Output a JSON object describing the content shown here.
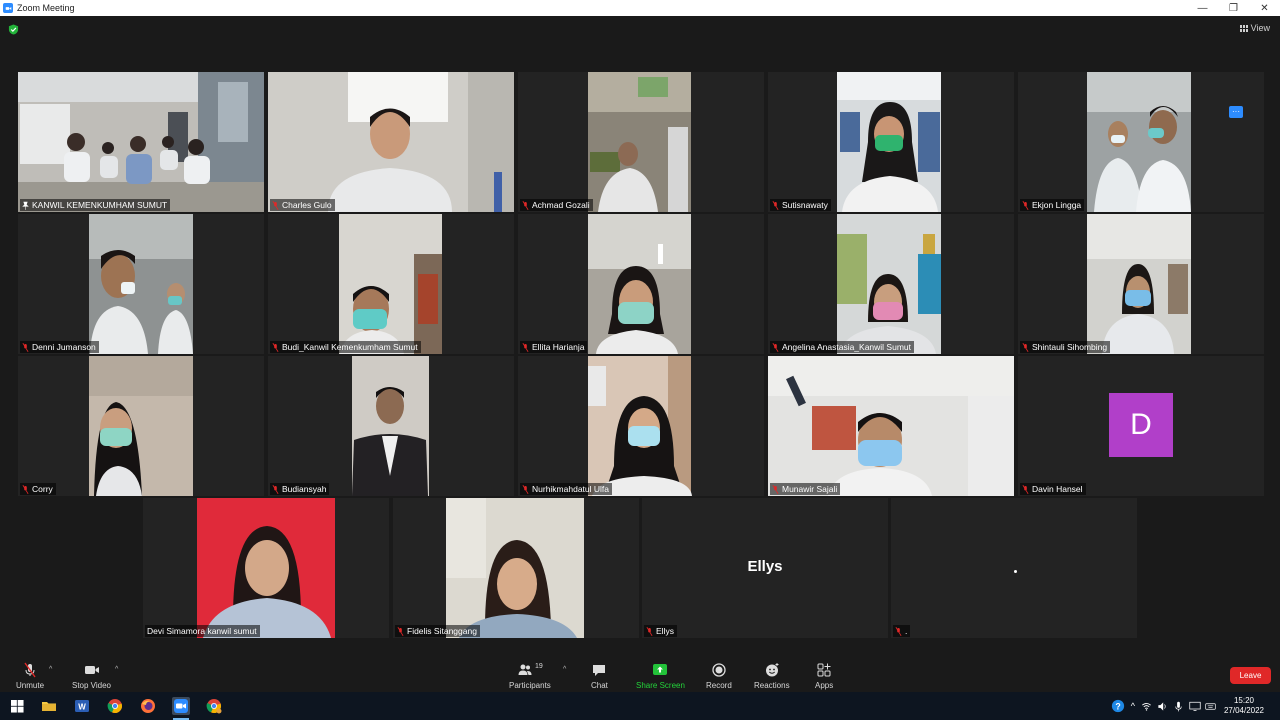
{
  "window": {
    "title": "Zoom Meeting",
    "minimize": "—",
    "restore": "❐",
    "close": "✕"
  },
  "topbar": {
    "view_label": "View"
  },
  "participants_tiles": [
    {
      "name": "KANWIL KEMENKUMHAM SUMUT",
      "active": true
    },
    {
      "name": "Charles Gulo"
    },
    {
      "name": "Achmad Gozali"
    },
    {
      "name": "Sutisnawaty"
    },
    {
      "name": "Ekjon Lingga"
    },
    {
      "name": "Denni Jumanson"
    },
    {
      "name": "Budi_Kanwil Kemenkumham Sumut"
    },
    {
      "name": "Ellita Harianja"
    },
    {
      "name": "Angelina Anastasia_Kanwil Sumut"
    },
    {
      "name": "Shintauli Sihombing"
    },
    {
      "name": "Corry"
    },
    {
      "name": "Budiansyah"
    },
    {
      "name": "Nurhikmahdatul Ulfa"
    },
    {
      "name": "Munawir Sajali"
    },
    {
      "name": "Davin Hansel",
      "avatar_letter": "D"
    },
    {
      "name": "Devi Simamora kanwil sumut"
    },
    {
      "name": "Fidelis Sitanggang"
    },
    {
      "name": "Ellys",
      "display_name": "Ellys"
    },
    {
      "name": ".",
      "display_name": "."
    }
  ],
  "toolbar": {
    "unmute": "Unmute",
    "stop_video": "Stop Video",
    "participants": "Participants",
    "participants_count": "19",
    "chat": "Chat",
    "share_screen": "Share Screen",
    "record": "Record",
    "reactions": "Reactions",
    "apps": "Apps",
    "leave": "Leave"
  },
  "taskbar": {
    "time": "15:20",
    "date": "27/04/2022"
  },
  "colors": {
    "active_speaker": "#c8e64b",
    "leave": "#e02828",
    "share": "#23c33a",
    "avatar_d": "#b13fc9"
  }
}
